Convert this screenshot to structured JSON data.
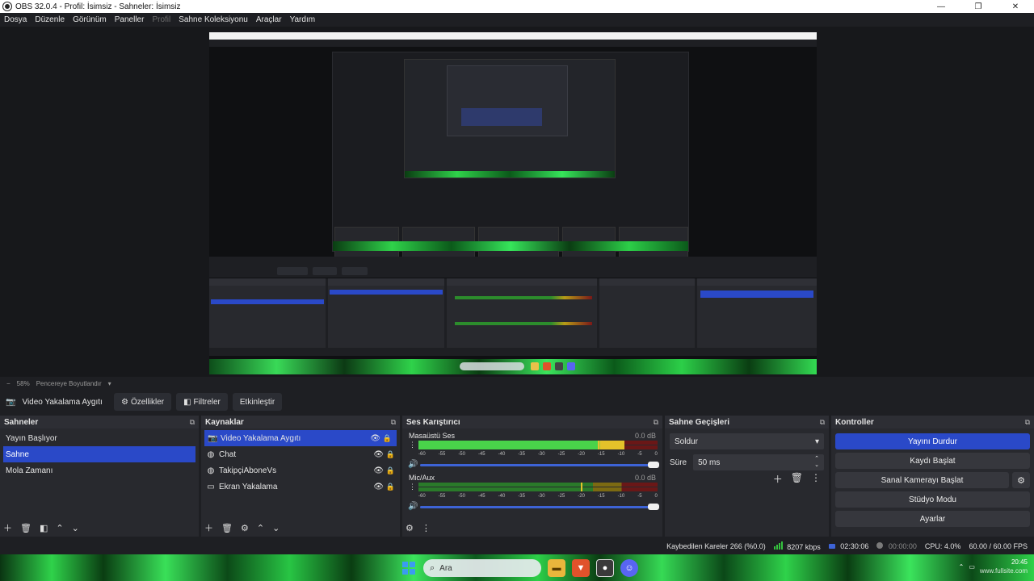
{
  "window": {
    "title": "OBS 32.0.4 - Profil: İsimsiz - Sahneler: İsimsiz",
    "minimize": "—",
    "maximize": "❐",
    "close": "✕"
  },
  "menu": [
    {
      "label": "Dosya",
      "enabled": true
    },
    {
      "label": "Düzenle",
      "enabled": true
    },
    {
      "label": "Görünüm",
      "enabled": true
    },
    {
      "label": "Paneller",
      "enabled": true
    },
    {
      "label": "Profil",
      "enabled": false
    },
    {
      "label": "Sahne Koleksiyonu",
      "enabled": true
    },
    {
      "label": "Araçlar",
      "enabled": true
    },
    {
      "label": "Yardım",
      "enabled": true
    }
  ],
  "zoom": {
    "minus": "−",
    "level": "58%",
    "mode": "Pencereye Boyutlandır",
    "chevron": "▾"
  },
  "source_toolbar": {
    "icon": "camera-icon",
    "source_name": "Video Yakalama Aygıtı",
    "properties": "Özellikler",
    "filters": "Filtreler",
    "activate": "Etkinleştir"
  },
  "scenes": {
    "title": "Sahneler",
    "items": [
      "Yayın Başlıyor",
      "Sahne",
      "Mola Zamanı"
    ],
    "selected_index": 1
  },
  "sources": {
    "title": "Kaynaklar",
    "items": [
      {
        "name": "Video Yakalama Aygıtı",
        "icon": "camera-icon"
      },
      {
        "name": "Chat",
        "icon": "globe-icon"
      },
      {
        "name": "TakipçiAboneVs",
        "icon": "globe-icon"
      },
      {
        "name": "Ekran Yakalama",
        "icon": "monitor-icon"
      }
    ],
    "selected_index": 0
  },
  "mixer": {
    "title": "Ses Karıştırıcı",
    "tracks": [
      {
        "name": "Masaüstü Ses",
        "db": "0.0 dB",
        "level": 0.86,
        "peak": 0.75
      },
      {
        "name": "Mic/Aux",
        "db": "0.0 dB",
        "level": 0.0,
        "peak": 0.68
      }
    ],
    "ticks": [
      "-60",
      "-55",
      "-50",
      "-45",
      "-40",
      "-35",
      "-30",
      "-25",
      "-20",
      "-15",
      "-10",
      "-5",
      "0"
    ]
  },
  "transitions": {
    "title": "Sahne Geçişleri",
    "selected": "Soldur",
    "duration_label": "Süre",
    "duration_value": "50 ms"
  },
  "controls": {
    "title": "Kontroller",
    "stop_stream": "Yayını Durdur",
    "start_recording": "Kaydı Başlat",
    "start_virtual_cam": "Sanal Kamerayı Başlat",
    "studio_mode": "Stüdyo Modu",
    "settings": "Ayarlar"
  },
  "status": {
    "dropped_frames": "Kaybedilen Kareler 266 (%0.0)",
    "bitrate": "8207 kbps",
    "stream_time": "02:30:06",
    "record_time": "00:00:00",
    "cpu": "CPU: 4.0%",
    "fps": "60.00 / 60.00 FPS"
  },
  "taskbar": {
    "search": "Ara",
    "time": "20:45",
    "date": "www.fullsite.com"
  },
  "colors": {
    "accent": "#2a49c8",
    "meter_green": "#49d34a",
    "meter_yellow": "#e4c22a",
    "meter_red": "#7a1818"
  }
}
